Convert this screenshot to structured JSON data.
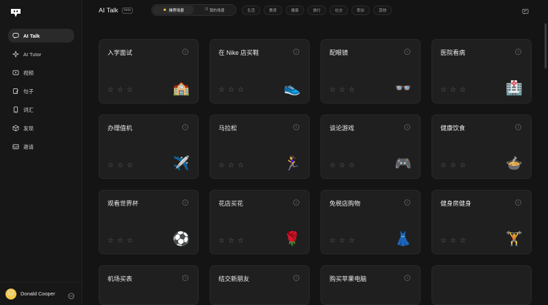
{
  "sidebar": {
    "items": [
      {
        "label": "AI Talk",
        "icon": "chat-icon",
        "active": true
      },
      {
        "label": "AI Tutor",
        "icon": "sparkle-icon",
        "active": false
      },
      {
        "label": "视频",
        "icon": "play-icon",
        "active": false
      },
      {
        "label": "句子",
        "icon": "edit-icon",
        "active": false
      },
      {
        "label": "词汇",
        "icon": "phone-icon",
        "active": false
      },
      {
        "label": "发现",
        "icon": "cube-icon",
        "active": false
      },
      {
        "label": "邀请",
        "icon": "mail-icon",
        "active": false
      }
    ],
    "user": {
      "name": "Donald Cooper",
      "avatar": "🐱"
    }
  },
  "header": {
    "title": "AI Talk",
    "badge": "beta",
    "toggle": {
      "recommended": "推荐场景",
      "mine": "我的场景"
    },
    "categories": [
      "生活",
      "教育",
      "健康",
      "旅行",
      "社交",
      "职业",
      "其他"
    ]
  },
  "cards": [
    {
      "title": "入学面试",
      "emoji": "🏫"
    },
    {
      "title": "在 Nike 店买鞋",
      "emoji": "👟"
    },
    {
      "title": "配眼镜",
      "emoji": "👓"
    },
    {
      "title": "医院看病",
      "emoji": "🏥"
    },
    {
      "title": "办理值机",
      "emoji": "✈️"
    },
    {
      "title": "马拉松",
      "emoji": "🏃‍♀️"
    },
    {
      "title": "谈论游戏",
      "emoji": "🎮"
    },
    {
      "title": "健康饮食",
      "emoji": "🍲"
    },
    {
      "title": "观看世界杯",
      "emoji": "⚽"
    },
    {
      "title": "花店买花",
      "emoji": "🌹"
    },
    {
      "title": "免税店购物",
      "emoji": "👗"
    },
    {
      "title": "健身房健身",
      "emoji": "🏋️"
    },
    {
      "title": "机场买表",
      "emoji": ""
    },
    {
      "title": "结交新朋友",
      "emoji": ""
    },
    {
      "title": "购买苹果电脑",
      "emoji": ""
    },
    {
      "title": "",
      "emoji": ""
    }
  ],
  "stars": "☆",
  "colors": {
    "background": "#141414",
    "card": "#1f1f1f",
    "sidebar": "#171717",
    "active": "#2a2a2a"
  }
}
